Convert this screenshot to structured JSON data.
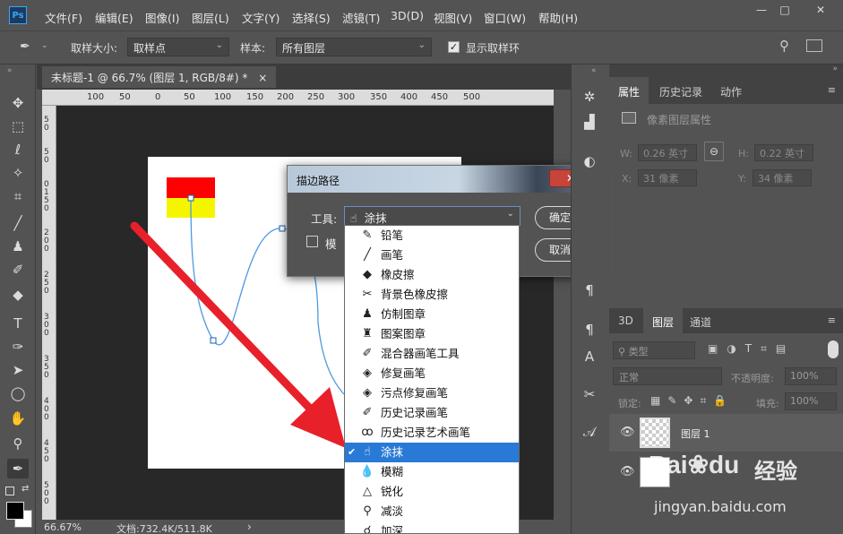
{
  "app": {
    "logo": "Ps",
    "menu": [
      "文件(F)",
      "编辑(E)",
      "图像(I)",
      "图层(L)",
      "文字(Y)",
      "选择(S)",
      "滤镜(T)",
      "3D(D)",
      "视图(V)",
      "窗口(W)",
      "帮助(H)"
    ],
    "window_controls": [
      "—",
      "□",
      "✕"
    ]
  },
  "options": {
    "sample_size_label": "取样大小:",
    "sample_size_value": "取样点",
    "sample_label": "样本:",
    "sample_value": "所有图层",
    "show_ring_label": "显示取样环",
    "show_ring_checked": true
  },
  "document": {
    "tab_title": "未标题-1 @ 66.7% (图层 1, RGB/8#) *",
    "close": "×",
    "ruler_h": [
      "100",
      "50",
      "0",
      "50",
      "100",
      "150",
      "200",
      "250",
      "300",
      "350",
      "400",
      "450",
      "500"
    ],
    "ruler_v": [
      "5",
      "0",
      "5",
      "0",
      "0",
      "1",
      "5",
      "0",
      "2",
      "0",
      "0",
      "2",
      "5",
      "0",
      "3",
      "0",
      "0",
      "3",
      "5",
      "0",
      "4",
      "0",
      "0",
      "4",
      "5",
      "0",
      "5",
      "0",
      "0"
    ],
    "zoom": "66.67%",
    "doc_info": "文档:732.4K/511.8K",
    "status_arrow": "›"
  },
  "dialog": {
    "title": "描边路径",
    "close": "✕",
    "tool_label": "工具:",
    "tool_value": "涂抹",
    "simulate_label": "模",
    "ok": "确定",
    "cancel": "取消"
  },
  "dropdown": [
    {
      "label": "铅笔",
      "icon": "pencil-icon",
      "glyph": "✎"
    },
    {
      "label": "画笔",
      "icon": "brush-icon",
      "glyph": "╱"
    },
    {
      "label": "橡皮擦",
      "icon": "eraser-icon",
      "glyph": "◆"
    },
    {
      "label": "背景色橡皮擦",
      "icon": "background-eraser-icon",
      "glyph": "✂"
    },
    {
      "label": "仿制图章",
      "icon": "clone-stamp-icon",
      "glyph": "♟"
    },
    {
      "label": "图案图章",
      "icon": "pattern-stamp-icon",
      "glyph": "♜"
    },
    {
      "label": "混合器画笔工具",
      "icon": "mixer-brush-icon",
      "glyph": "✐"
    },
    {
      "label": "修复画笔",
      "icon": "healing-brush-icon",
      "glyph": "◈"
    },
    {
      "label": "污点修复画笔",
      "icon": "spot-healing-icon",
      "glyph": "◈"
    },
    {
      "label": "历史记录画笔",
      "icon": "history-brush-icon",
      "glyph": "✐"
    },
    {
      "label": "历史记录艺术画笔",
      "icon": "art-history-brush-icon",
      "glyph": "ꝏ"
    },
    {
      "label": "涂抹",
      "icon": "smudge-icon",
      "glyph": "☝",
      "selected": true,
      "check": "✔"
    },
    {
      "label": "模糊",
      "icon": "blur-icon",
      "glyph": "💧"
    },
    {
      "label": "锐化",
      "icon": "sharpen-icon",
      "glyph": "△"
    },
    {
      "label": "减淡",
      "icon": "dodge-icon",
      "glyph": "⚲"
    },
    {
      "label": "加深",
      "icon": "burn-icon",
      "glyph": "☌"
    }
  ],
  "properties": {
    "tabs": [
      "属性",
      "历史记录",
      "动作"
    ],
    "header": "像素图层属性",
    "w_label": "W:",
    "w_value": "0.26 英寸",
    "h_label": "H:",
    "h_value": "0.22 英寸",
    "x_label": "X:",
    "x_value": "31 像素",
    "y_label": "Y:",
    "y_value": "34 像素"
  },
  "layers": {
    "tabs": [
      "3D",
      "图层",
      "通道"
    ],
    "filter_value": "类型",
    "blend_mode": "正常",
    "opacity_label": "不透明度:",
    "opacity_value": "100%",
    "lock_label": "锁定:",
    "fill_label": "填充:",
    "fill_value": "100%",
    "layer1_name": "图层 1"
  },
  "watermark": {
    "brand": "Bai",
    "brand2": "du",
    "cn": "经验",
    "url": "jingyan.baidu.com"
  },
  "colors": {
    "accent_arrow": "#e8202a",
    "selection_blue": "#2979d6"
  }
}
